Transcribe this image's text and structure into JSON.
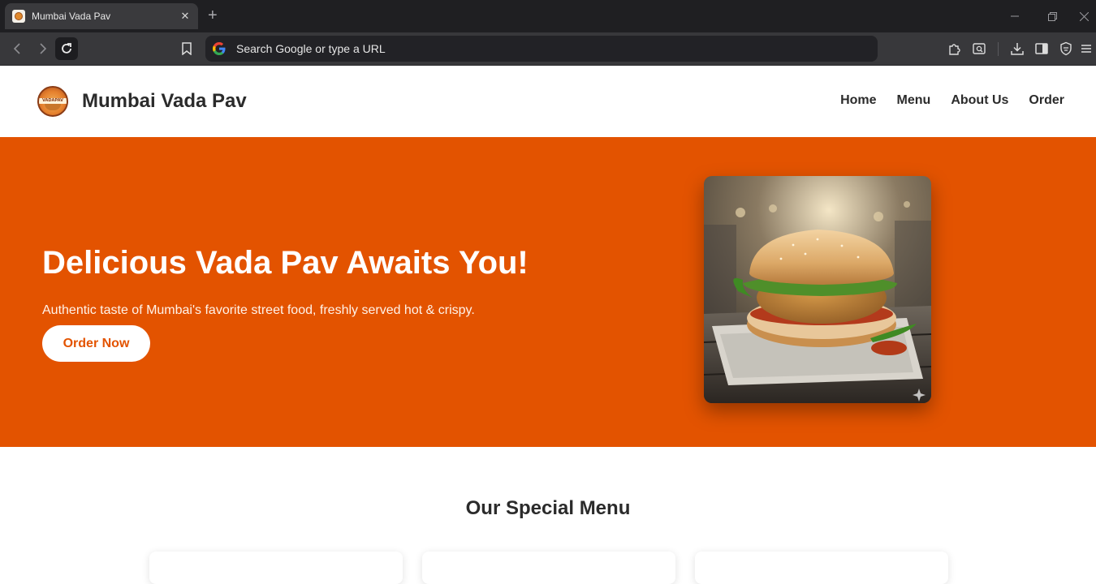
{
  "browser": {
    "tab_title": "Mumbai Vada Pav",
    "omnibox_placeholder": "Search Google or type a URL"
  },
  "site": {
    "brand": "Mumbai Vada Pav",
    "logo_text": "VADAPAV",
    "nav": [
      {
        "label": "Home"
      },
      {
        "label": "Menu"
      },
      {
        "label": "About Us"
      },
      {
        "label": "Order"
      }
    ]
  },
  "hero": {
    "title": "Delicious Vada Pav Awaits You!",
    "subtitle": "Authentic taste of Mumbai's favorite street food, freshly served hot & crispy.",
    "cta_label": "Order Now"
  },
  "menu_section": {
    "title": "Our Special Menu"
  },
  "colors": {
    "accent": "#e35300",
    "chrome_dark": "#1f1f22",
    "toolbar": "#38383b"
  }
}
